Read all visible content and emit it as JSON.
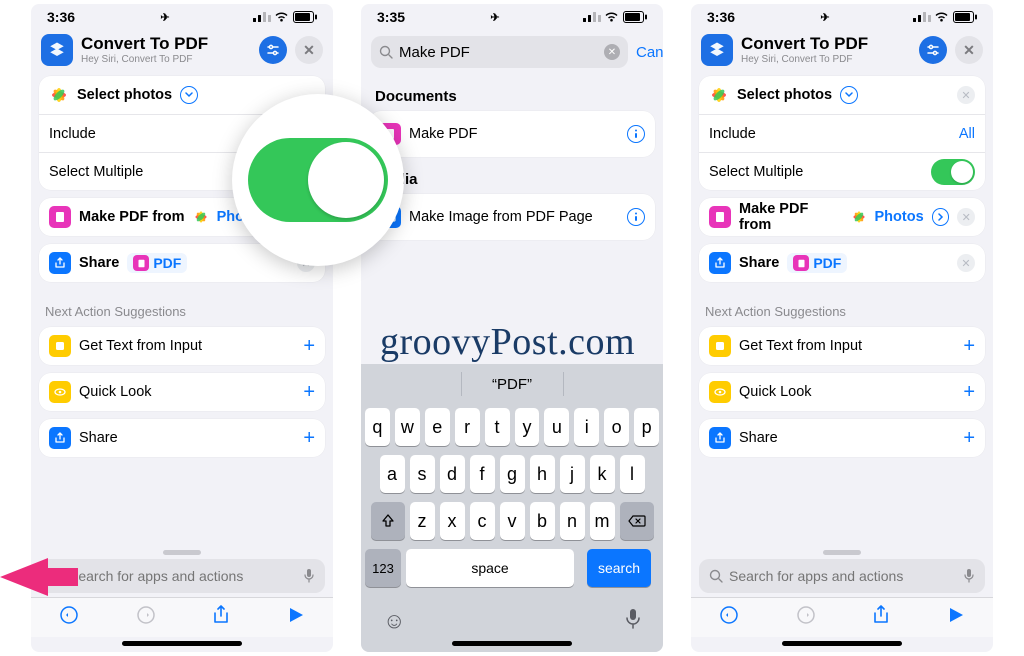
{
  "watermark": "groovyPost.com",
  "phone1": {
    "time": "3:36",
    "title": "Convert To PDF",
    "subtitle": "Hey Siri, Convert To PDF",
    "select_photos": "Select photos",
    "include": "Include",
    "select_multiple": "Select Multiple",
    "make_pdf_prefix": "Make PDF from",
    "make_pdf_param": "Photos",
    "share_label": "Share",
    "share_param": "PDF",
    "sugg_title": "Next Action Suggestions",
    "sugg": [
      "Get Text from Input",
      "Quick Look",
      "Share"
    ],
    "search_placeholder": "Search for apps and actions"
  },
  "phone2": {
    "time": "3:35",
    "query": "Make PDF",
    "cancel": "Cancel",
    "sec1": "Documents",
    "res1": "Make PDF",
    "sec2": "Media",
    "res2": "Make Image from PDF Page",
    "kb_suggestion": "“PDF”",
    "row1": [
      "q",
      "w",
      "e",
      "r",
      "t",
      "y",
      "u",
      "i",
      "o",
      "p"
    ],
    "row2": [
      "a",
      "s",
      "d",
      "f",
      "g",
      "h",
      "j",
      "k",
      "l"
    ],
    "row3": [
      "z",
      "x",
      "c",
      "v",
      "b",
      "n",
      "m"
    ],
    "num_key": "123",
    "space_key": "space",
    "search_key": "search"
  },
  "phone3": {
    "time": "3:36",
    "title": "Convert To PDF",
    "subtitle": "Hey Siri, Convert To PDF",
    "select_photos": "Select photos",
    "include": "Include",
    "include_value": "All",
    "select_multiple": "Select Multiple",
    "make_pdf_prefix": "Make PDF from",
    "make_pdf_param": "Photos",
    "share_label": "Share",
    "share_param": "PDF",
    "sugg_title": "Next Action Suggestions",
    "sugg": [
      "Get Text from Input",
      "Quick Look",
      "Share"
    ],
    "search_placeholder": "Search for apps and actions"
  }
}
